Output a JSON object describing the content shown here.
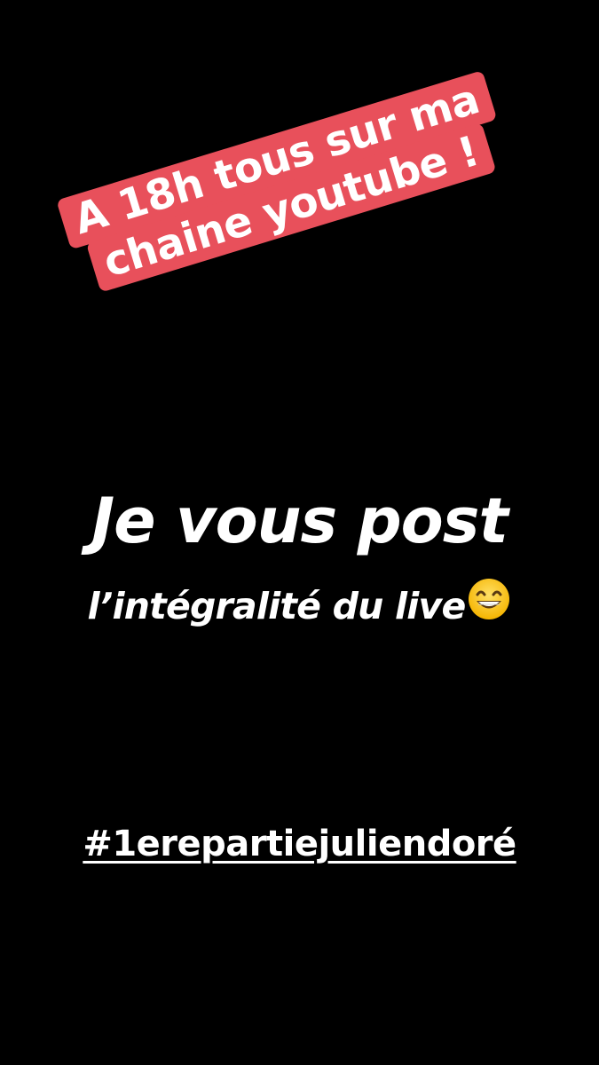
{
  "sticker": {
    "line1": "A 18h tous sur ma",
    "line2": "chaine youtube !",
    "background_color": "#e8505b",
    "text_color": "#ffffff"
  },
  "caption": {
    "headline": "Je vous post",
    "subline": "l’intégralité du live",
    "emoji": "grinning-face-with-smiling-eyes-icon"
  },
  "hashtag": {
    "text": "#1erepartiejuliendoré"
  },
  "colors": {
    "background": "#000000",
    "text": "#ffffff"
  }
}
